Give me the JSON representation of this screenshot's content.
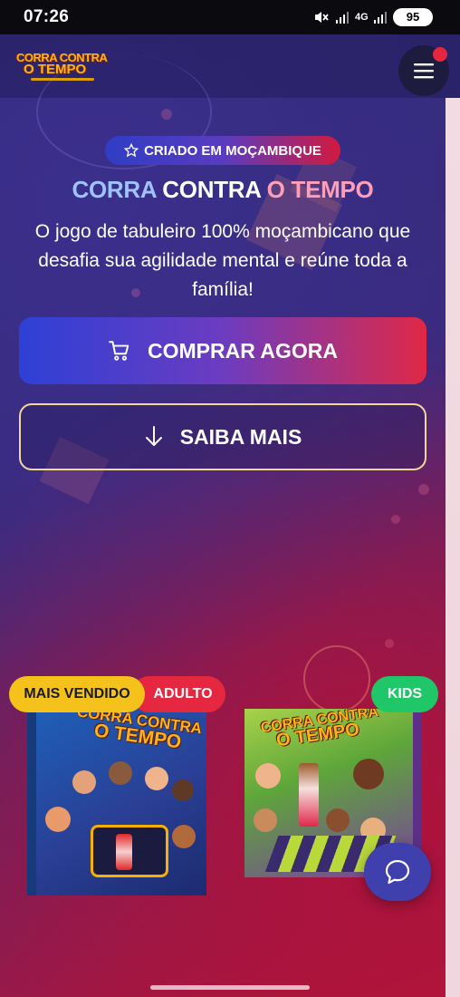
{
  "status_bar": {
    "time": "07:26",
    "battery": "95",
    "network": "4G"
  },
  "header": {
    "logo_line1": "CORRA CONTRA",
    "logo_line2": "O TEMPO"
  },
  "hero": {
    "badge": "CRIADO EM MOÇAMBIQUE",
    "title_part1": "CORRA ",
    "title_part2": "CONTRA ",
    "title_part3": "O ",
    "title_part4": "TEMPO",
    "subtitle": "O jogo de tabuleiro 100% moçambicano que desafia sua agilidade mental e reúne toda a família!",
    "buy_label": "COMPRAR AGORA",
    "more_label": "SAIBA MAIS"
  },
  "products": {
    "adult_tag": "ADULTO",
    "bestseller_tag": "MAIS VENDIDO",
    "kids_tag": "KIDS",
    "adult_box_title_1": "CORRA CONTRA",
    "adult_box_title_2": "O TEMPO",
    "kids_box_title_1": "CORRA CONTRA",
    "kids_box_title_2": "O TEMPO"
  },
  "colors": {
    "accent_red": "#e5283f",
    "accent_blue": "#2e40d6",
    "bestseller_yellow": "#f4c21a",
    "kids_green": "#1fc768"
  },
  "icons": {
    "menu": "hamburger-icon",
    "star": "star-icon",
    "cart": "cart-icon",
    "arrow": "arrow-down-icon",
    "chat": "chat-icon"
  }
}
